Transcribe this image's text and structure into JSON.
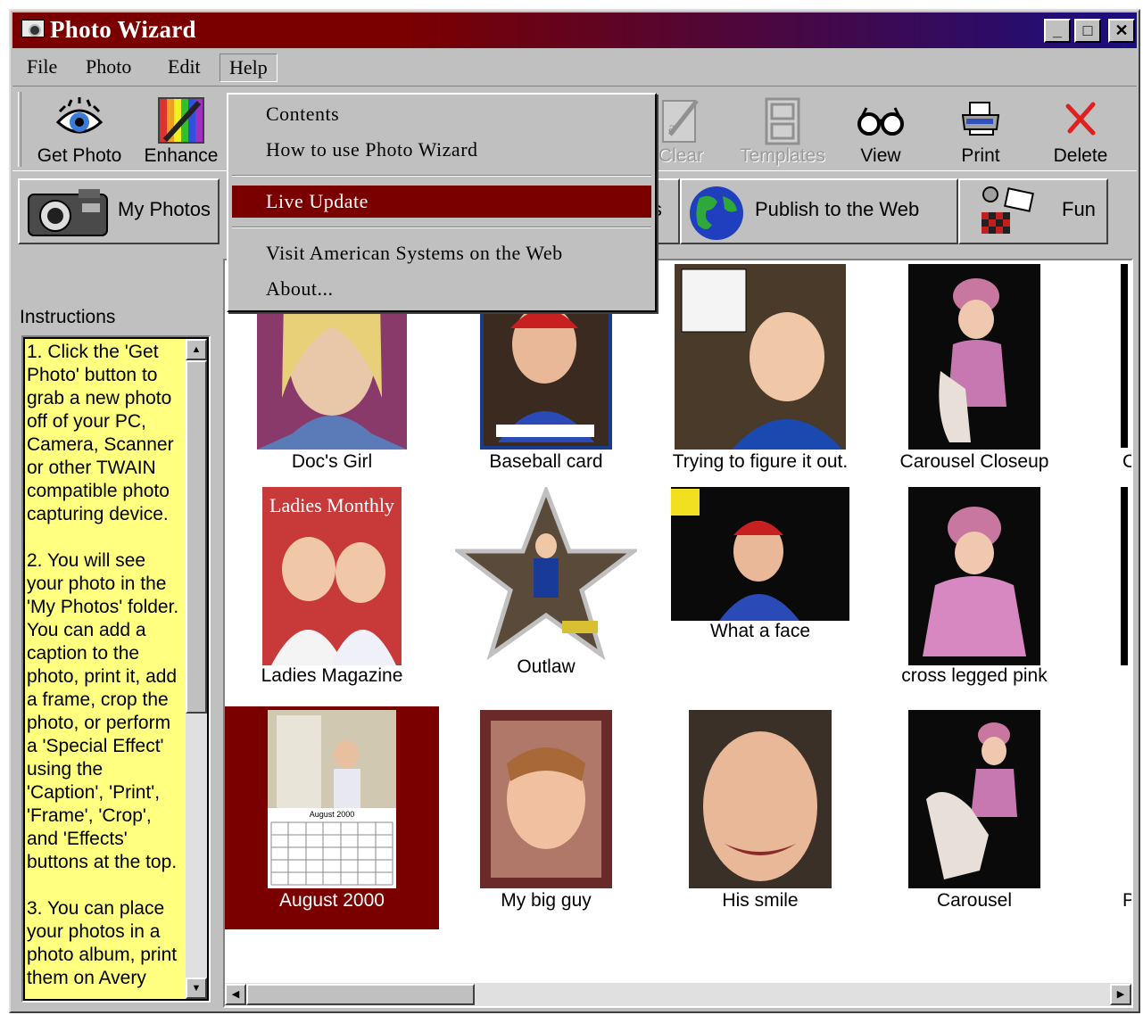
{
  "window": {
    "title": "Photo Wizard",
    "minimize": "_",
    "maximize": "□",
    "close": "✕"
  },
  "menu": {
    "file": "File",
    "photo": "Photo",
    "edit": "Edit",
    "help": "Help"
  },
  "help_menu": {
    "contents": "Contents",
    "how_to": "How to use Photo Wizard",
    "live_update": "Live Update",
    "visit": "Visit American Systems on the Web",
    "about": "About..."
  },
  "toolbar": {
    "get_photo": "Get Photo",
    "enhance": "Enhance",
    "clear": "Clear",
    "templates": "Templates",
    "view": "View",
    "print": "Print",
    "delete": "Delete"
  },
  "tabs": {
    "my_photos": "My Photos",
    "partial": "ls",
    "publish": "Publish to the Web",
    "fun": "Fun"
  },
  "instructions": {
    "label": "Instructions",
    "text": "1. Click the 'Get Photo' button to grab a new photo off of your PC, Camera, Scanner or other TWAIN compatible photo capturing device.\n\n2. You will see your photo in the 'My Photos' folder. You can add a caption to the photo, print it, add a frame, crop the photo, or perform a 'Special Effect' using the 'Caption', 'Print', 'Frame', 'Crop', and 'Effects' buttons at the top.\n\n3. You can place your photos in a photo album, print them on Avery"
  },
  "photos": [
    {
      "caption": "Doc's Girl"
    },
    {
      "caption": "Baseball card"
    },
    {
      "caption": "Trying to figure it out."
    },
    {
      "caption": "Carousel Closeup"
    },
    {
      "caption": "Ladies Magazine"
    },
    {
      "caption": "Outlaw"
    },
    {
      "caption": "What a face"
    },
    {
      "caption": "cross legged pink"
    },
    {
      "caption": "August 2000"
    },
    {
      "caption": "My big guy"
    },
    {
      "caption": "His smile"
    },
    {
      "caption": "Carousel"
    }
  ],
  "photo_text": {
    "magazine_title": "Ladies Monthly",
    "calendar_month": "August 2000",
    "partial_c": "C",
    "partial_p": "P"
  },
  "colors": {
    "selection": "#7a0000",
    "instructions_bg": "#ffff80",
    "titlebar_end": "#1a0f80"
  }
}
